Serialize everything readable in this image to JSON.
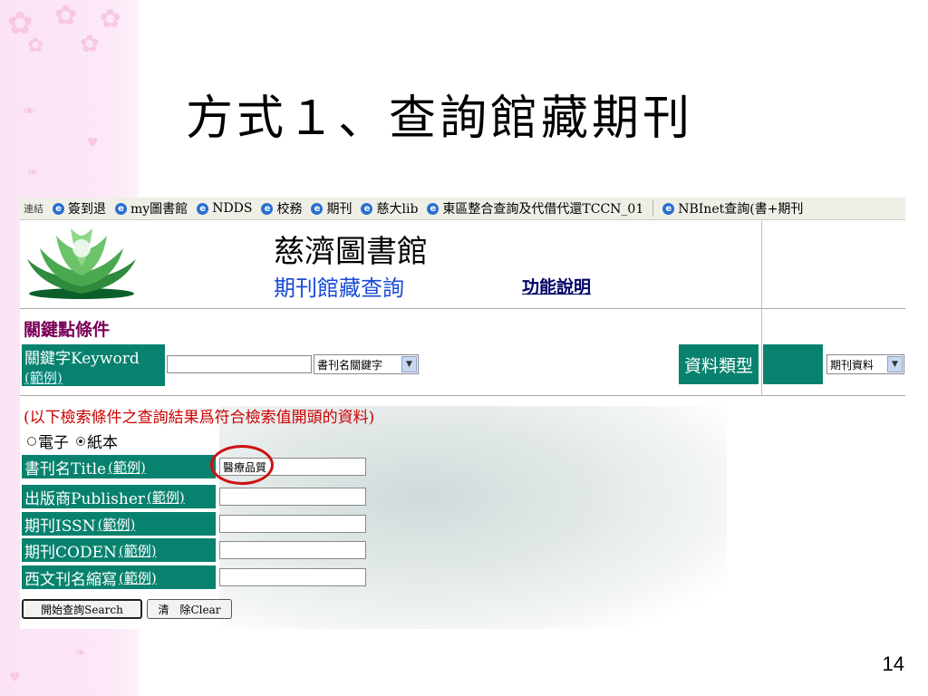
{
  "slide": {
    "title": "方式１、查詢館藏期刊",
    "page_number": "14"
  },
  "linkbar": {
    "label": "連結",
    "links": [
      "簽到退",
      "my圖書館",
      "NDDS",
      "校務",
      "期刊",
      "慈大lib",
      "東區整合查詢及代借代還TCCN_01",
      "NBInet查詢(書+期刊"
    ]
  },
  "header": {
    "library_name": "慈濟圖書館",
    "page_subtitle": "期刊館藏查詢",
    "help_link": "功能說明"
  },
  "keyword_section": {
    "heading": "關鍵點條件",
    "label": "關鍵字Keyword",
    "example": "(範例)",
    "input_value": "",
    "select_value": "書刊名關鍵字",
    "type_label": "資料類型",
    "type_select_value": "期刊資料"
  },
  "filter_note": "(以下檢索條件之查詢結果爲符合檢索值開頭的資料)",
  "format_radios": [
    {
      "label": "電子",
      "selected": false
    },
    {
      "label": "紙本",
      "selected": true
    }
  ],
  "fields": [
    {
      "label": "書刊名Title",
      "example": "(範例)",
      "value": "醫療品質"
    },
    {
      "label": "出版商Publisher",
      "example": "(範例)",
      "value": ""
    },
    {
      "label": "期刊ISSN",
      "example": "(範例)",
      "value": ""
    },
    {
      "label": "期刊CODEN",
      "example": "(範例)",
      "value": ""
    },
    {
      "label": "西文刊名縮寫",
      "example": "(範例)",
      "value": ""
    }
  ],
  "buttons": {
    "search": "開始查詢Search",
    "clear": "清　除Clear"
  },
  "colors": {
    "teal": "#08826e",
    "title_link_blue": "#1a4bd6",
    "heading_purple": "#7a0057",
    "note_red": "#cc0000",
    "highlight_red": "#cc1111"
  }
}
